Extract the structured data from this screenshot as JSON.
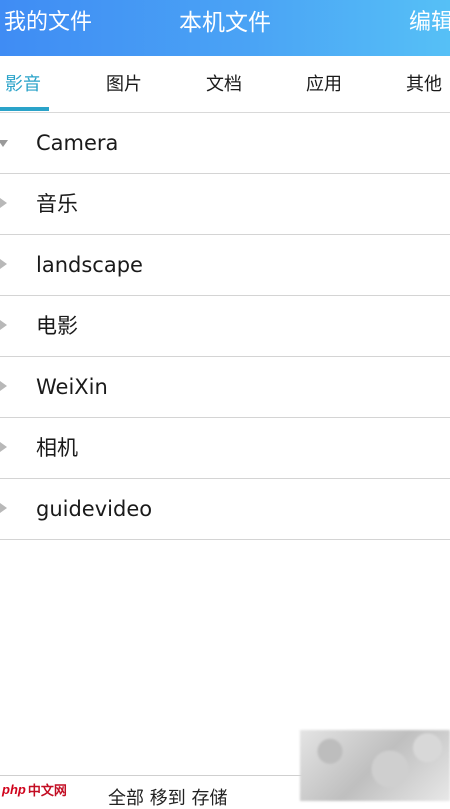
{
  "header": {
    "left_label": "我的文件",
    "title": "本机文件",
    "right_label": "编辑"
  },
  "tabs": [
    {
      "label": "影音",
      "active": true
    },
    {
      "label": "图片",
      "active": false
    },
    {
      "label": "文档",
      "active": false
    },
    {
      "label": "应用",
      "active": false
    },
    {
      "label": "其他",
      "active": false
    }
  ],
  "folders": [
    {
      "name": "Camera",
      "expanded": true
    },
    {
      "name": "音乐",
      "expanded": false
    },
    {
      "name": "landscape",
      "expanded": false
    },
    {
      "name": "电影",
      "expanded": false
    },
    {
      "name": "WeiXin",
      "expanded": false
    },
    {
      "name": "相机",
      "expanded": false
    },
    {
      "name": "guidevideo",
      "expanded": false
    }
  ],
  "footer": {
    "watermark_site": "中文网",
    "watermark_brand": "php",
    "partial_text": "全部 移到 存储"
  },
  "colors": {
    "header_gradient_start": "#3f8cf4",
    "header_gradient_end": "#56c0f6",
    "tab_active": "#2aa3c9"
  }
}
